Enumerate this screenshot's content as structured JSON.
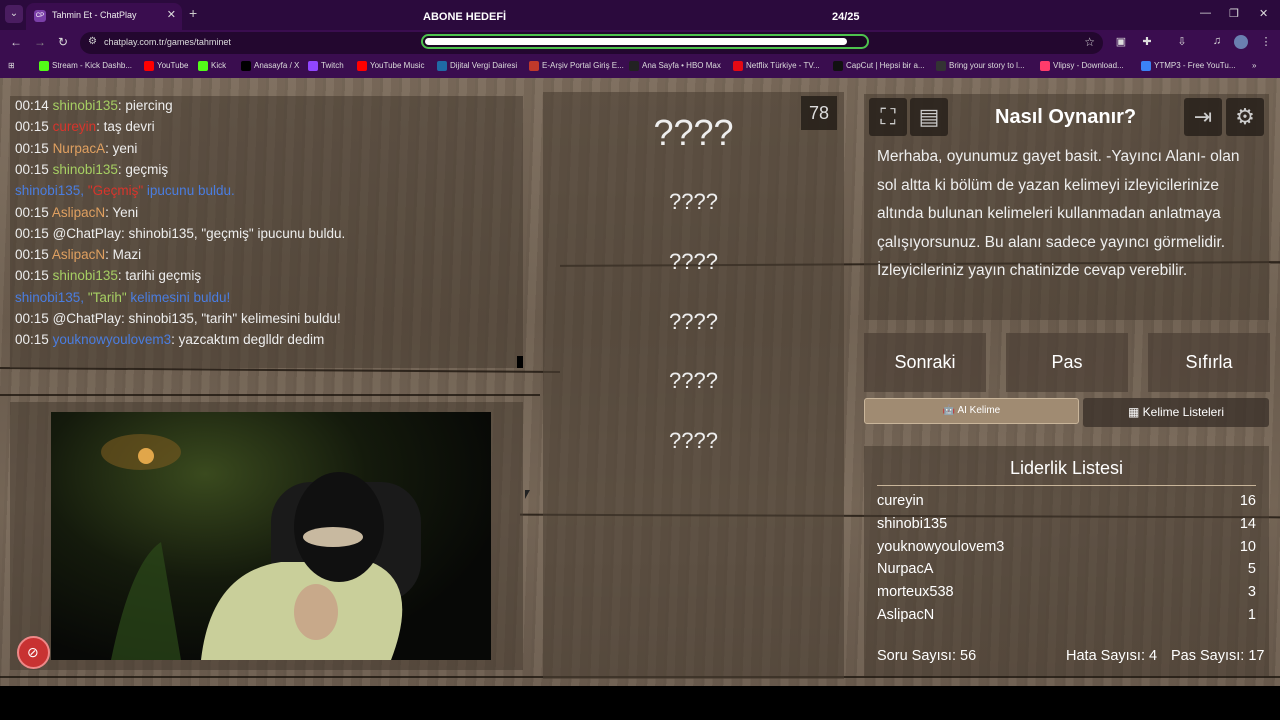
{
  "browser": {
    "tab_title": "Tahmin Et - ChatPlay",
    "tab_favicon": "CP",
    "url": "chatplay.com.tr/games/tahminet",
    "bookmarks": [
      {
        "label": "Stream - Kick Dashb...",
        "icon": "kick-icon",
        "color": "#53fc18"
      },
      {
        "label": "YouTube",
        "icon": "youtube-icon",
        "color": "#ff0000"
      },
      {
        "label": "Kick",
        "icon": "kick-icon",
        "color": "#53fc18"
      },
      {
        "label": "Anasayfa / X",
        "icon": "x-icon",
        "color": "#000000"
      },
      {
        "label": "Twitch",
        "icon": "twitch-icon",
        "color": "#9146ff"
      },
      {
        "label": "YouTube Music",
        "icon": "youtube-music-icon",
        "color": "#ff0000"
      },
      {
        "label": "Dijital Vergi Dairesi",
        "icon": "gov-icon",
        "color": "#1f6aa5"
      },
      {
        "label": "E-Arşiv Portal Giriş E...",
        "icon": "doc-icon",
        "color": "#c0392b"
      },
      {
        "label": "Ana Sayfa • HBO Max",
        "icon": "hbo-icon",
        "color": "#222222"
      },
      {
        "label": "Netflix Türkiye - TV...",
        "icon": "netflix-icon",
        "color": "#e50914"
      },
      {
        "label": "CapCut | Hepsi bir a...",
        "icon": "capcut-icon",
        "color": "#111111"
      },
      {
        "label": "Bring your story to l...",
        "icon": "canva-icon",
        "color": "#333333"
      },
      {
        "label": "Vlipsy - Download...",
        "icon": "vlipsy-icon",
        "color": "#ff3b6b"
      },
      {
        "label": "YTMP3 - Free YouTu...",
        "icon": "ytmp3-icon",
        "color": "#3b82f6"
      }
    ]
  },
  "overlay": {
    "goal_label": "ABONE HEDEFİ",
    "goal_count": "24/25",
    "goal_progress": 0.96,
    "bar_color": "#4ec24e"
  },
  "chat": [
    {
      "time": "00:14",
      "user": "shinobi135",
      "user_color": "#a6cf63",
      "text": ": piercing"
    },
    {
      "time": "00:15",
      "user": "cureyin",
      "user_color": "#d9342b",
      "text": ": taş devri"
    },
    {
      "time": "00:15",
      "user": "NurpacA",
      "user_color": "#e0a060",
      "text": ": yeni"
    },
    {
      "time": "00:15",
      "user": "shinobi135",
      "user_color": "#a6cf63",
      "text": ": geçmiş"
    },
    {
      "time": "",
      "user": "shinobi135, ",
      "user_color": "#4a7de0",
      "text": "\"Geçmiş\"",
      "text_color": "#d9342b",
      "suffix": " ipucunu buldu.",
      "suffix_color": "#4a7de0"
    },
    {
      "time": "00:15",
      "user": "AslipacN",
      "user_color": "#e0a060",
      "text": ": Yeni"
    },
    {
      "time": "00:15",
      "user": "@ChatPlay",
      "user_color": "#eeeeee",
      "text": ": shinobi135, \"geçmiş\" ipucunu buldu."
    },
    {
      "time": "00:15",
      "user": "AslipacN",
      "user_color": "#e0a060",
      "text": ": Mazi"
    },
    {
      "time": "00:15",
      "user": "shinobi135",
      "user_color": "#a6cf63",
      "text": ": tarihi geçmiş"
    },
    {
      "time": "",
      "user": "shinobi135, ",
      "user_color": "#4a7de0",
      "text": "\"Tarih\"",
      "text_color": "#a6cf63",
      "suffix": " kelimesini buldu!",
      "suffix_color": "#4a7de0"
    },
    {
      "time": "00:15",
      "user": "@ChatPlay",
      "user_color": "#eeeeee",
      "text": ": shinobi135, \"tarih\" kelimesini buldu!"
    },
    {
      "time": "00:15",
      "user": "youknowyoulovem3",
      "user_color": "#4a7de0",
      "text": ": yazcaktım deglldr dedim"
    }
  ],
  "game": {
    "score": "78",
    "hidden_words": [
      "????",
      "????",
      "????",
      "????",
      "????",
      "????"
    ]
  },
  "rules": {
    "title": "Nasıl Oynanır?",
    "text": "Merhaba, oyunumuz gayet basit. -Yayıncı Alanı- olan sol altta ki bölüm de yazan kelimeyi izleyicilerinize altında bulunan kelimeleri kullanmadan anlatmaya çalışıyorsunuz. Bu alanı sadece yayıncı görmelidir. İzleyicileriniz yayın chatinizde cevap verebilir."
  },
  "controls": {
    "next": "Sonraki",
    "pass": "Pas",
    "reset": "Sıfırla",
    "ai_word": "AI Kelime",
    "word_lists": "Kelime Listeleri"
  },
  "leaderboard": {
    "title": "Liderlik Listesi",
    "entries": [
      {
        "name": "cureyin",
        "score": "16"
      },
      {
        "name": "shinobi135",
        "score": "14"
      },
      {
        "name": "youknowyoulovem3",
        "score": "10"
      },
      {
        "name": "NurpacA",
        "score": "5"
      },
      {
        "name": "morteux538",
        "score": "3"
      },
      {
        "name": "AslipacN",
        "score": "1"
      }
    ]
  },
  "stats": {
    "questions": "Soru Sayısı: 56",
    "errors": "Hata Sayısı: 4",
    "passes": "Pas Sayısı: 17"
  }
}
